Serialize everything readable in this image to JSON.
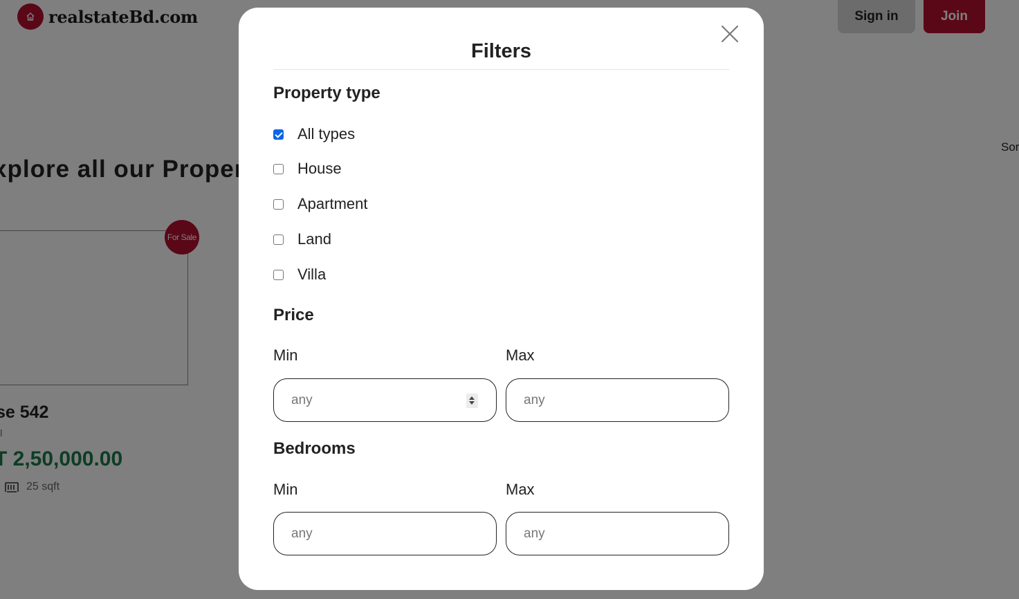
{
  "site": {
    "logo_text": "realstateBd.com",
    "sign_in_label": "Sign in",
    "join_label": "Join",
    "sort_text": "Sor",
    "heading": "xplore all our Propert",
    "brand_color": "#b50e2e"
  },
  "card": {
    "badge": "For Sale",
    "title": "se 542",
    "subtitle": "il",
    "price": "T 2,50,000.00",
    "area": "25 sqft",
    "price_color": "#1a7a4a"
  },
  "filters": {
    "title": "Filters",
    "property_type": {
      "heading": "Property type",
      "options": [
        {
          "label": "All types",
          "checked": true
        },
        {
          "label": "House",
          "checked": false
        },
        {
          "label": "Apartment",
          "checked": false
        },
        {
          "label": "Land",
          "checked": false
        },
        {
          "label": "Villa",
          "checked": false
        }
      ]
    },
    "price": {
      "heading": "Price",
      "min_label": "Min",
      "max_label": "Max",
      "min_placeholder": "any",
      "max_placeholder": "any"
    },
    "bedrooms": {
      "heading": "Bedrooms",
      "min_label": "Min",
      "max_label": "Max",
      "min_placeholder": "any",
      "max_placeholder": "any"
    }
  }
}
